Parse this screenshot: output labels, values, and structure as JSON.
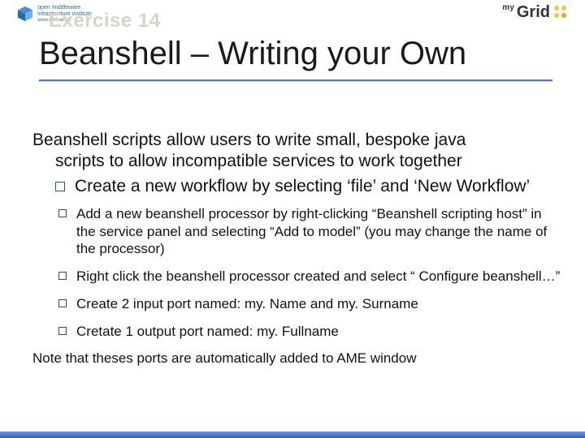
{
  "logos": {
    "left_line1": "open middleware",
    "left_line2": "infrastructure institute",
    "left_url": "www.omii.ac.uk",
    "right_my": "my",
    "right_grid": "Grid"
  },
  "header": {
    "exercise": "Exercise 14",
    "title": "Beanshell – Writing your Own"
  },
  "body": {
    "lead_line1": "Beanshell scripts allow users to write small, bespoke java",
    "lead_line2": "scripts to allow incompatible services to work together",
    "big_bullet": "Create a new workflow by selecting ‘file’ and ‘New Workflow’",
    "small_bullets": [
      "Add a new beanshell processor by right-clicking “Beanshell scripting host” in the service panel  and selecting “Add to model” (you may change the name of the processor)",
      "Right click the beanshell processor created and select “ Configure beanshell…”",
      "Create 2 input port named: my. Name and my. Surname",
      "Cretate 1 output port named: my. Fullname"
    ],
    "note": "Note that theses ports are automatically added to AME window"
  }
}
